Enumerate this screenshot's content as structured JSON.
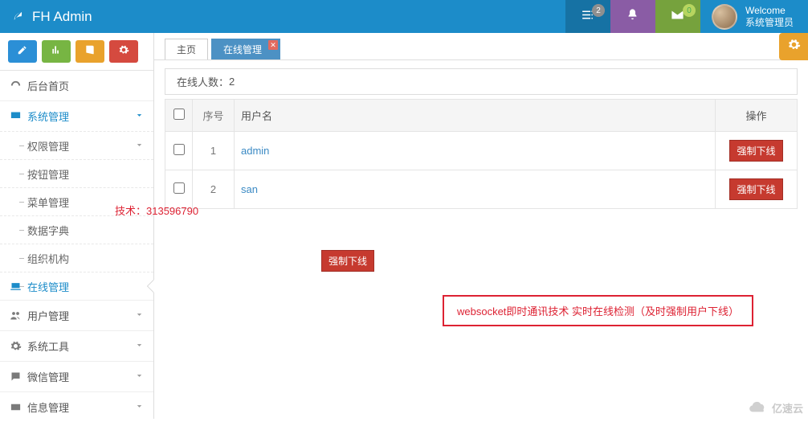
{
  "header": {
    "brand": "FH Admin",
    "notify_count": "2",
    "mail_count": "0",
    "welcome_l1": "Welcome",
    "welcome_l2": "系统管理员"
  },
  "sidebar": {
    "home": "后台首页",
    "group_sys": "系统管理",
    "sub_auth": "权限管理",
    "sub_btn": "按钮管理",
    "sub_menu": "菜单管理",
    "sub_dict": "数据字典",
    "sub_org": "组织机构",
    "sub_online": "在线管理",
    "group_user": "用户管理",
    "group_tool": "系统工具",
    "group_wechat": "微信管理",
    "group_info": "信息管理"
  },
  "tabs": {
    "home": "主页",
    "online": "在线管理"
  },
  "table": {
    "online_label": "在线人数：",
    "online_count": "2",
    "col_idx": "序号",
    "col_user": "用户名",
    "col_op": "操作",
    "rows": [
      {
        "idx": "1",
        "user": "admin"
      },
      {
        "idx": "2",
        "user": "san"
      }
    ],
    "force_label": "强制下线"
  },
  "overlay": {
    "tech_label": "技术：313596790",
    "float_force": "强制下线",
    "info_box": "websocket即时通讯技术    实时在线检测（及时强制用户下线）"
  },
  "watermark": "亿速云"
}
